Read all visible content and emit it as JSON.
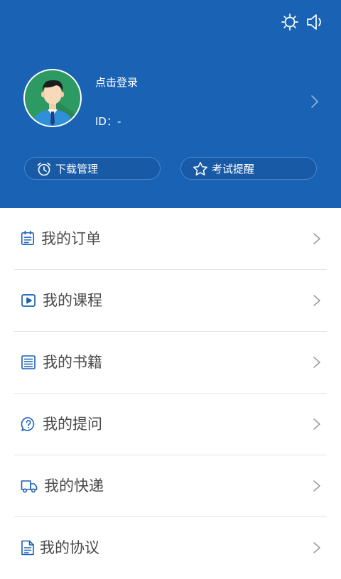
{
  "header": {
    "login_text": "点击登录",
    "id_text": "ID：-",
    "buttons": [
      {
        "label": "下载管理",
        "icon": "alarm-clock-icon"
      },
      {
        "label": "考试提醒",
        "icon": "star-icon"
      }
    ],
    "top_icons": [
      "settings-icon",
      "volume-icon"
    ]
  },
  "menu": {
    "items": [
      {
        "label": "我的订单",
        "icon": "clipboard-icon"
      },
      {
        "label": "我的课程",
        "icon": "video-play-icon"
      },
      {
        "label": "我的书籍",
        "icon": "book-list-icon"
      },
      {
        "label": "我的提问",
        "icon": "question-bubble-icon"
      },
      {
        "label": "我的快递",
        "icon": "delivery-truck-icon"
      },
      {
        "label": "我的协议",
        "icon": "document-icon"
      }
    ]
  },
  "colors": {
    "header_bg": "#1a63b4",
    "accent_icon": "#1a5fb4",
    "text_primary": "#4a4a4a",
    "chevron": "#9a9a9a",
    "divider": "#e3e3e3"
  }
}
